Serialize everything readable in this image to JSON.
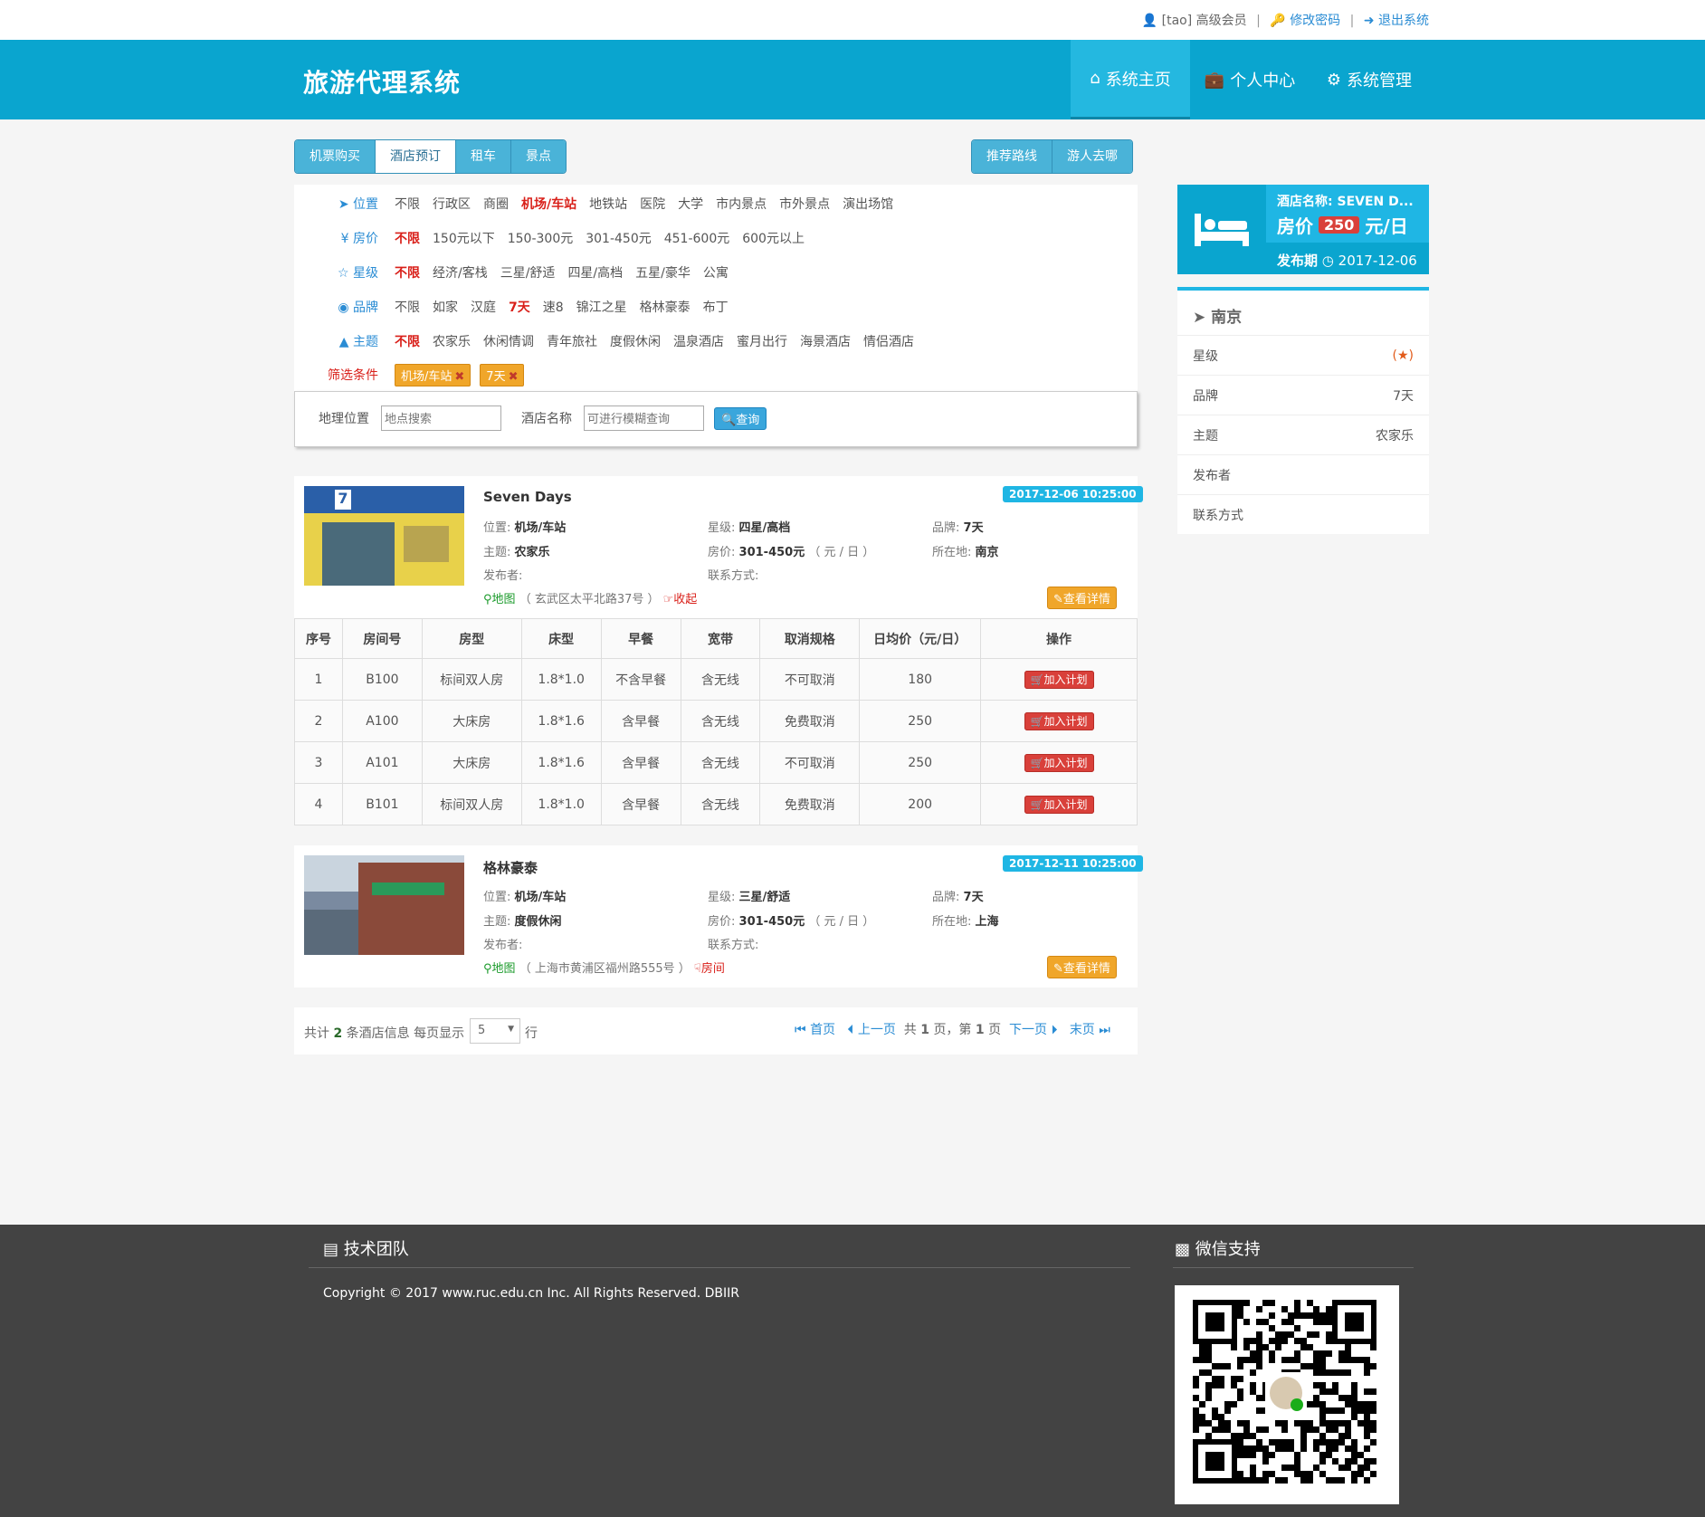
{
  "topbar": {
    "user": "[tao] 高级会员",
    "change_pwd": "修改密码",
    "logout": "退出系统"
  },
  "header": {
    "brand": "旅游代理系统",
    "nav": [
      "系统主页",
      "个人中心",
      "系统管理"
    ]
  },
  "tabs": {
    "left": [
      "机票购买",
      "酒店预订",
      "租车",
      "景点"
    ],
    "right": [
      "推荐路线",
      "游人去哪"
    ],
    "active": "酒店预订"
  },
  "filters": [
    {
      "label": "位置",
      "options": [
        "不限",
        "行政区",
        "商圈",
        "机场/车站",
        "地铁站",
        "医院",
        "大学",
        "市内景点",
        "市外景点",
        "演出场馆"
      ],
      "selected": "机场/车站"
    },
    {
      "label": "房价",
      "options": [
        "不限",
        "150元以下",
        "150-300元",
        "301-450元",
        "451-600元",
        "600元以上"
      ],
      "selected": "不限"
    },
    {
      "label": "星级",
      "options": [
        "不限",
        "经济/客栈",
        "三星/舒适",
        "四星/高档",
        "五星/豪华",
        "公寓"
      ],
      "selected": "不限"
    },
    {
      "label": "品牌",
      "options": [
        "不限",
        "如家",
        "汉庭",
        "7天",
        "速8",
        "锦江之星",
        "格林豪泰",
        "布丁"
      ],
      "selected": "7天"
    },
    {
      "label": "主题",
      "options": [
        "不限",
        "农家乐",
        "休闲情调",
        "青年旅社",
        "度假休闲",
        "温泉酒店",
        "蜜月出行",
        "海景酒店",
        "情侣酒店"
      ],
      "selected": "不限"
    }
  ],
  "conditions": {
    "label": "筛选条件",
    "chips": [
      "机场/车站",
      "7天"
    ]
  },
  "search": {
    "geo_label": "地理位置",
    "geo_placeholder": "地点搜索",
    "name_label": "酒店名称",
    "name_placeholder": "可进行模糊查询",
    "button": "查询"
  },
  "hotels": [
    {
      "name": "Seven Days",
      "date": "2017-12-06 10:25:00",
      "location_label": "位置:",
      "location": "机场/车站",
      "star_label": "星级:",
      "star": "四星/高档",
      "brand_label": "品牌:",
      "brand": "7天",
      "theme_label": "主题:",
      "theme": "农家乐",
      "price_label": "房价:",
      "price": "301-450元",
      "price_unit": "（ 元 / 日 ）",
      "city_label": "所在地:",
      "city": "南京",
      "publisher_label": "发布者:",
      "contact_label": "联系方式:",
      "map": "地图",
      "address": "（ 玄武区太平北路37号 ）",
      "toggle": "收起",
      "detail": "查看详情"
    },
    {
      "name": "格林豪泰",
      "date": "2017-12-11 10:25:00",
      "location_label": "位置:",
      "location": "机场/车站",
      "star_label": "星级:",
      "star": "三星/舒适",
      "brand_label": "品牌:",
      "brand": "7天",
      "theme_label": "主题:",
      "theme": "度假休闲",
      "price_label": "房价:",
      "price": "301-450元",
      "price_unit": "（ 元 / 日 ）",
      "city_label": "所在地:",
      "city": "上海",
      "publisher_label": "发布者:",
      "contact_label": "联系方式:",
      "map": "地图",
      "address": "（ 上海市黄浦区福州路555号 ）",
      "toggle": "房间",
      "detail": "查看详情"
    }
  ],
  "rooms": {
    "headers": [
      "序号",
      "房间号",
      "房型",
      "床型",
      "早餐",
      "宽带",
      "取消规格",
      "日均价（元/日）",
      "操作"
    ],
    "rows": [
      [
        "1",
        "B100",
        "标间双人房",
        "1.8*1.0",
        "不含早餐",
        "含无线",
        "不可取消",
        "180"
      ],
      [
        "2",
        "A100",
        "大床房",
        "1.8*1.6",
        "含早餐",
        "含无线",
        "免费取消",
        "250"
      ],
      [
        "3",
        "A101",
        "大床房",
        "1.8*1.6",
        "含早餐",
        "含无线",
        "不可取消",
        "250"
      ],
      [
        "4",
        "B101",
        "标间双人房",
        "1.8*1.0",
        "含早餐",
        "含无线",
        "免费取消",
        "200"
      ]
    ],
    "action": "加入计划"
  },
  "pagination": {
    "total_pre": "共计",
    "total": "2",
    "total_post": "条酒店信息 每页显示",
    "per_page": "5",
    "per_page_post": "行",
    "first": "首页",
    "prev": "上一页",
    "gong": "共",
    "pages": "1",
    "ye": "页，第",
    "current": "1",
    "ye2": "页",
    "next": "下一页",
    "last": "末页"
  },
  "featured": {
    "name_label": "酒店名称:",
    "name": "SEVEN D...",
    "price_label": "房价",
    "price": "250",
    "price_unit": "元/日",
    "date_label": "发布期",
    "date": "2017-12-06"
  },
  "city": {
    "name": "南京",
    "rows": [
      {
        "label": "星级",
        "value": ""
      },
      {
        "label": "品牌",
        "value": "7天"
      },
      {
        "label": "主题",
        "value": "农家乐"
      },
      {
        "label": "发布者",
        "value": ""
      },
      {
        "label": "联系方式",
        "value": ""
      }
    ]
  },
  "footer": {
    "team": "技术团队",
    "copyright": "Copyright © 2017 www.ruc.edu.cn Inc. All Rights Reserved. DBIIR",
    "wechat": "微信支持"
  }
}
